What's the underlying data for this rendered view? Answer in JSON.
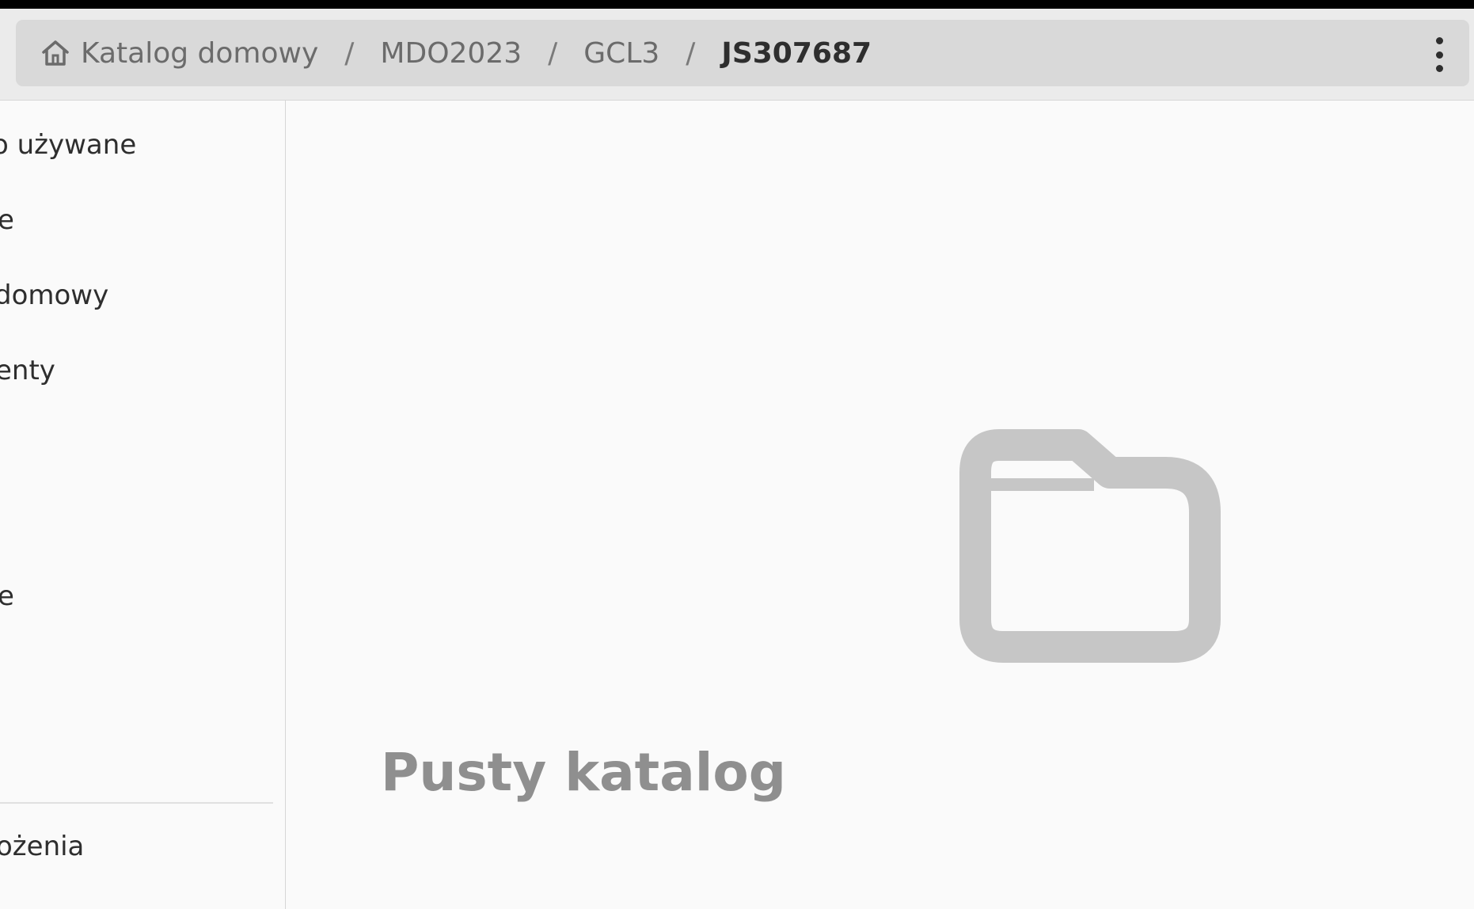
{
  "breadcrumb": {
    "items": [
      {
        "label": "Katalog domowy"
      },
      {
        "label": "MDO2023"
      },
      {
        "label": "GCL3"
      },
      {
        "label": "JS307687"
      }
    ],
    "separator": "/"
  },
  "sidebar": {
    "items": [
      {
        "label": "o używane"
      },
      {
        "label": "e"
      },
      {
        "label": " domowy"
      },
      {
        "label": "enty"
      },
      {
        "label": "e"
      },
      {
        "label": "ożenia"
      }
    ]
  },
  "content": {
    "empty_label": "Pusty katalog"
  },
  "icons": {
    "home": "home-icon",
    "menu": "more-vertical-icon",
    "folder": "folder-icon"
  },
  "colors": {
    "pathbar_bg": "#d9d9d9",
    "empty_state_gray": "#c6c6c6"
  }
}
